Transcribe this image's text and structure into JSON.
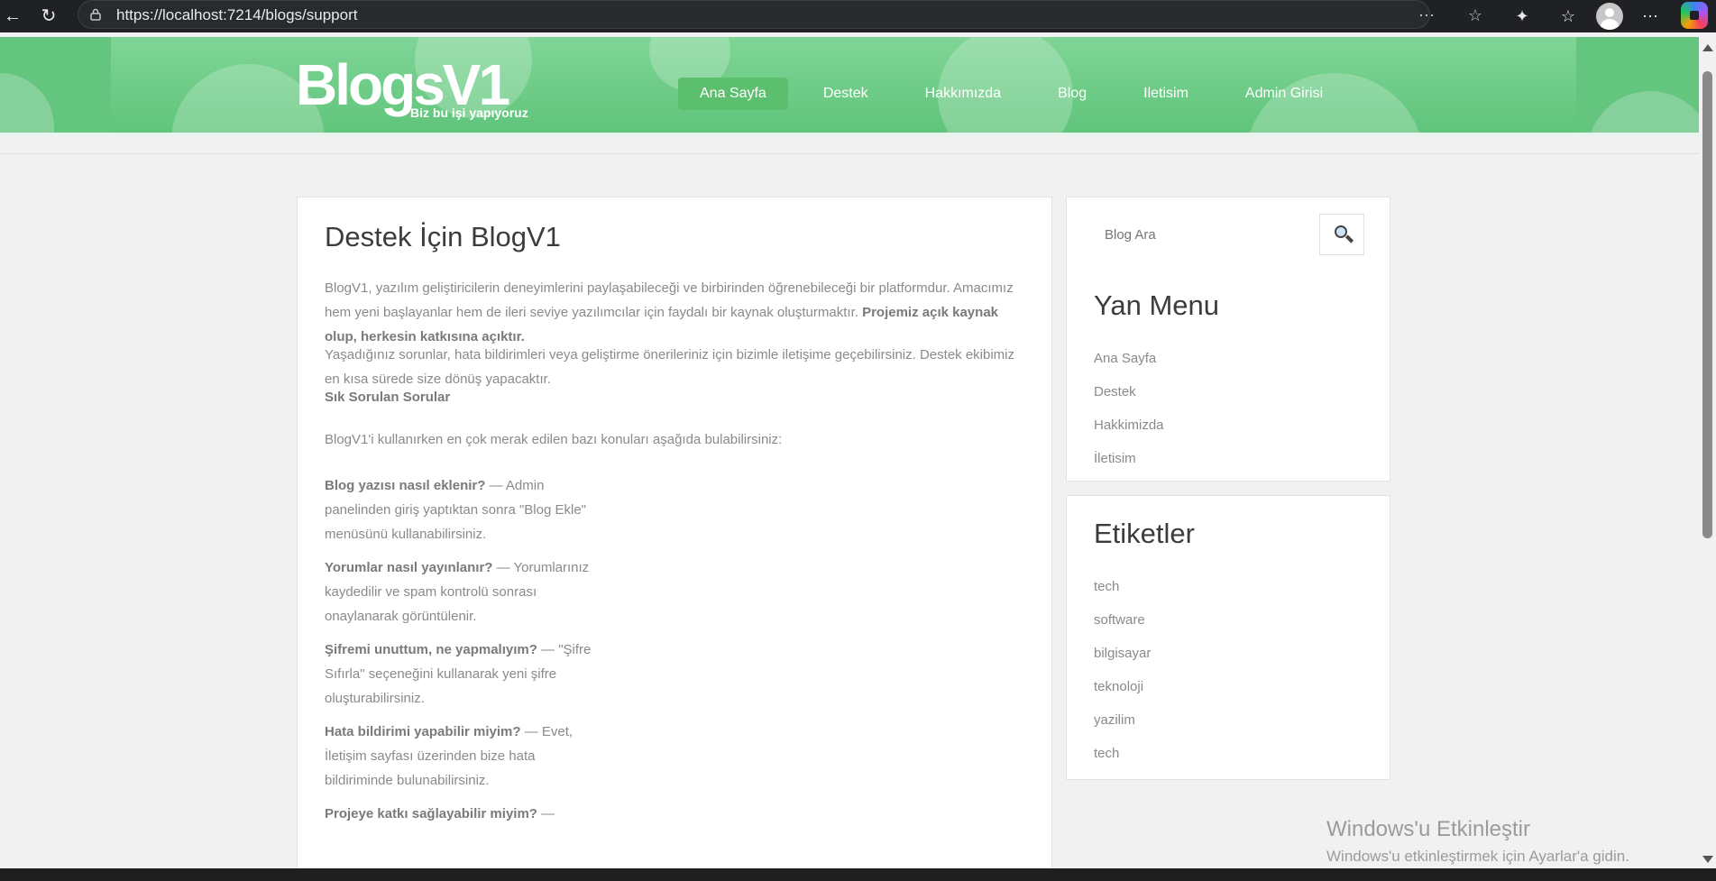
{
  "browser": {
    "url": "https://localhost:7214/blogs/support"
  },
  "site": {
    "logo_text": "BlogsV1",
    "tagline": "Biz bu işi yapıyoruz",
    "nav": [
      {
        "label": "Ana Sayfa",
        "active": true
      },
      {
        "label": "Destek",
        "active": false
      },
      {
        "label": "Hakkımızda",
        "active": false
      },
      {
        "label": "Blog",
        "active": false
      },
      {
        "label": "Iletisim",
        "active": false
      },
      {
        "label": "Admin Girisi",
        "active": false
      }
    ],
    "accent_color": "#5cbf6e"
  },
  "article": {
    "title": "Destek İçin BlogV1",
    "intro": "BlogV1, yazılım geliştiricilerin deneyimlerini paylaşabileceği ve birbirinden öğrenebileceği bir platformdur. Amacımız hem yeni başlayanlar hem de ileri seviye yazılımcılar için faydalı bir kaynak oluşturmaktır. ",
    "intro_bold": "Projemiz açık kaynak olup, herkesin katkısına açıktır.",
    "contact": "Yaşadığınız sorunlar, hata bildirimleri veya geliştirme önerileriniz için bizimle iletişime geçebilirsiniz. Destek ekibimiz en kısa sürede size dönüş yapacaktır.",
    "faq_heading": "Sık Sorulan Sorular",
    "faq_intro": "BlogV1'i kullanırken en çok merak edilen bazı konuları aşağıda bulabilirsiniz:",
    "faq": [
      {
        "q": "Blog yazısı nasıl eklenir?",
        "a": " — Admin panelinden giriş yaptıktan sonra \"Blog Ekle\" menüsünü kullanabilirsiniz."
      },
      {
        "q": "Yorumlar nasıl yayınlanır?",
        "a": " — Yorumlarınız kaydedilir ve spam kontrolü sonrası onaylanarak görüntülenir."
      },
      {
        "q": "Şifremi unuttum, ne yapmalıyım?",
        "a": " — \"Şifre Sıfırla\" seçeneğini kullanarak yeni şifre oluşturabilirsiniz."
      },
      {
        "q": "Hata bildirimi yapabilir miyim?",
        "a": " — Evet, İletişim sayfası üzerinden bize hata bildiriminde bulunabilirsiniz."
      },
      {
        "q": "Projeye katkı sağlayabilir miyim?",
        "a": " —"
      }
    ]
  },
  "sidebar": {
    "search_placeholder": "Blog Ara",
    "menu_title": "Yan Menu",
    "menu_items": [
      "Ana Sayfa",
      "Destek",
      "Hakkimizda",
      "İletisim"
    ],
    "tags_title": "Etiketler",
    "tags": [
      "tech",
      "software",
      "bilgisayar",
      "teknoloji",
      "yazilim",
      "tech"
    ]
  },
  "watermark": {
    "title": "Windows'u Etkinleştir",
    "subtitle": "Windows'u etkinleştirmek için Ayarlar'a gidin."
  }
}
